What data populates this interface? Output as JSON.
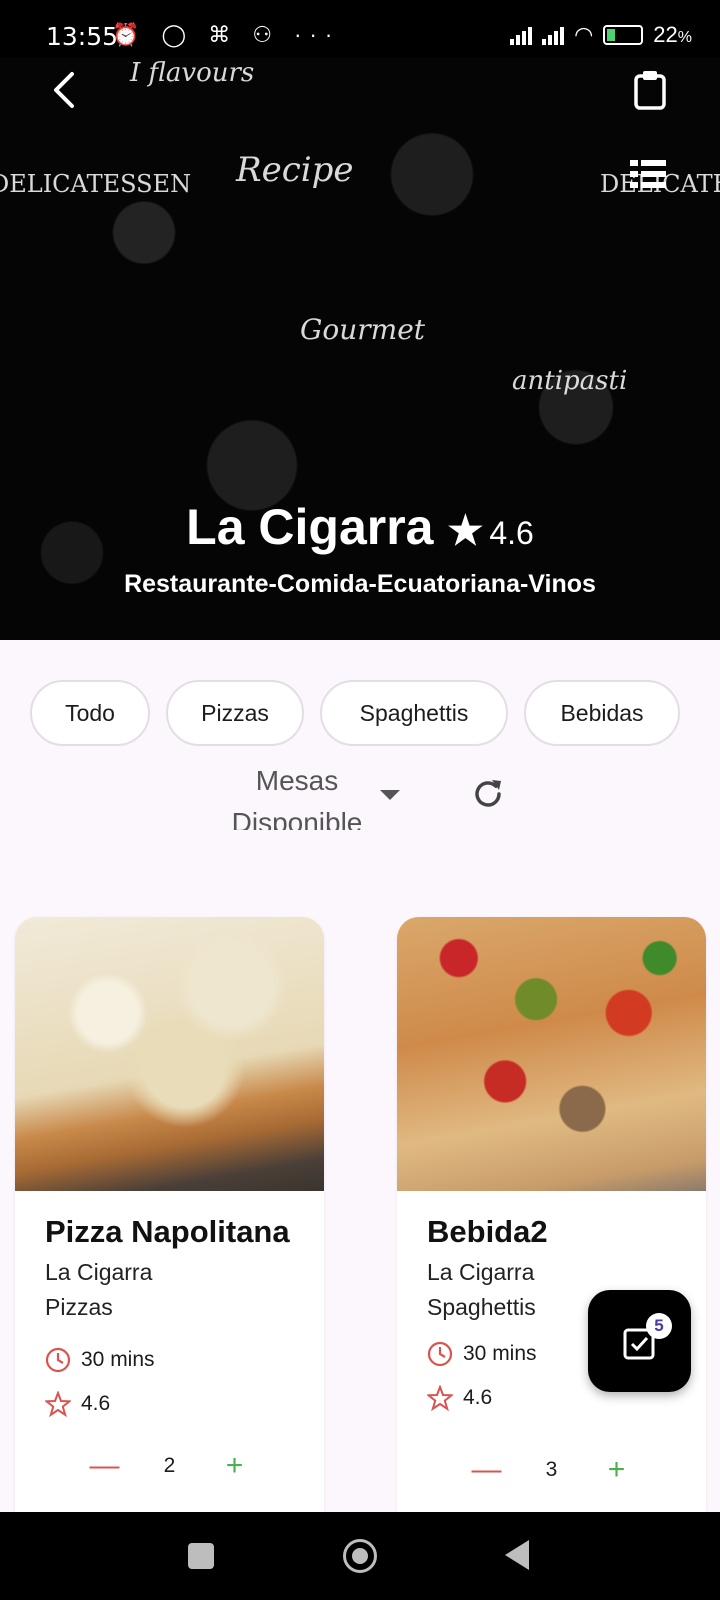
{
  "status_bar": {
    "time": "13:55",
    "battery_pct": "22",
    "battery_unit": "%"
  },
  "hero": {
    "restaurant_name": "La Cigarra",
    "rating": "4.6",
    "subtitle": "Restaurante-Comida-Ecuatoriana-Vinos",
    "background_words": [
      "I flavours",
      "Recipe",
      "DELICATESSEN",
      "Gourmet",
      "antipasti"
    ]
  },
  "chips": [
    "Todo",
    "Pizzas",
    "Spaghettis",
    "Bebidas"
  ],
  "dropdown": {
    "value": "Mesas Disponible"
  },
  "products": [
    {
      "name": "Pizza Napolitana",
      "restaurant": "La Cigarra",
      "category": "Pizzas",
      "time": "30 mins",
      "rating": "4.6",
      "quantity": "2",
      "minus": "—",
      "plus": "+"
    },
    {
      "name": "Bebida2",
      "restaurant": "La Cigarra",
      "category": "Spaghettis",
      "time": "30 mins",
      "rating": "4.6",
      "quantity": "3",
      "minus": "—",
      "plus": "+"
    }
  ],
  "fab": {
    "badge": "5"
  },
  "colors": {
    "accent_red": "#d9534f",
    "accent_green": "#4caf50",
    "badge_text": "#4a3aa8",
    "page_bg": "#fcf6fd"
  }
}
